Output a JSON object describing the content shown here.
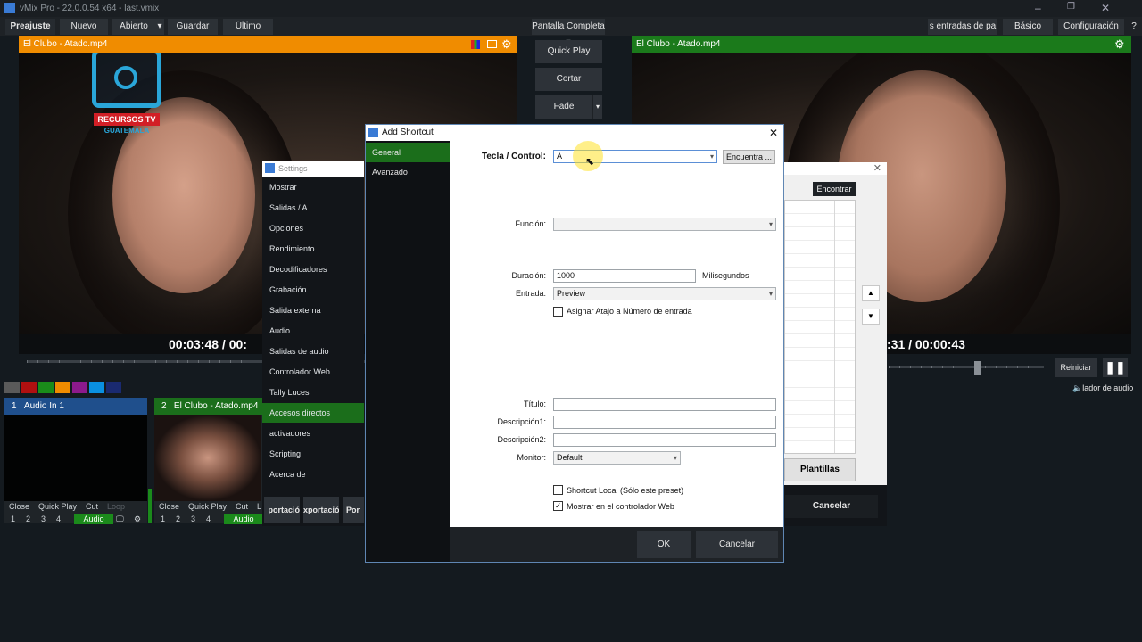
{
  "window": {
    "title": "vMix Pro - 22.0.0.54 x64 - last.vmix",
    "controls": [
      "–",
      "❐",
      "✕"
    ]
  },
  "toolbar": {
    "left": [
      "Preajuste",
      "Nuevo",
      "Abierto",
      "Guardar",
      "Último"
    ],
    "center": "Pantalla Completa",
    "right": [
      "s entradas de pa",
      "Básico",
      "Configuración"
    ],
    "help": "?"
  },
  "preview": {
    "title": "El Clubo - Atado.mp4",
    "timecode": "00:03:48  /  00:",
    "logo_line1": "RECURSOS TV",
    "logo_line2": "GUATEMALA"
  },
  "output": {
    "title": "El Clubo - Atado.mp4",
    "timecode": ":31  /  00:00:43",
    "restart": "Reiniciar",
    "audio_label": "lador de audio"
  },
  "transitions": {
    "quick_play": "Quick Play",
    "cut": "Cortar",
    "fade": "Fade"
  },
  "swatches": [
    "#5a5a5a",
    "#b01010",
    "#1a8c1a",
    "#f08c00",
    "#8c1a8c",
    "#0a90e0",
    "#1a2a70"
  ],
  "inputs": [
    {
      "number": "1",
      "name": "Audio In 1",
      "head_color": "#1f4f8c",
      "buttons": [
        "Close",
        "Quick Play",
        "Cut",
        "Loop"
      ],
      "nums": [
        "1",
        "2",
        "3",
        "4"
      ],
      "audio": "Audio"
    },
    {
      "number": "2",
      "name": "El Clubo - Atado.mp4",
      "head_color": "#1b6e1b",
      "buttons": [
        "Close",
        "Quick Play",
        "Cut",
        "L"
      ],
      "nums": [
        "1",
        "2",
        "3",
        "4"
      ],
      "audio": "Audio"
    }
  ],
  "settings": {
    "title": "Settings",
    "items": [
      "Mostrar",
      "Salidas / A",
      "Opciones",
      "Rendimiento",
      "Decodificadores",
      "Grabación",
      "Salida externa",
      "Audio",
      "Salidas de audio",
      "Controlador Web",
      "Tally Luces",
      "Accesos directos",
      "activadores",
      "Scripting",
      "Acerca de"
    ],
    "selected": "Accesos directos",
    "bottom_buttons": [
      "portació",
      "xportació",
      "Por c"
    ]
  },
  "shortcuts_window": {
    "find_button": "Encontrar",
    "templates_button": "Plantillas",
    "cancel_button": "Cancelar"
  },
  "dialog": {
    "title": "Add Shortcut",
    "tabs": [
      "General",
      "Avanzado"
    ],
    "selected_tab": "General",
    "key_label": "Tecla / Control:",
    "key_value": "A",
    "find_button": "Encuentra ...",
    "function_label": "Función:",
    "function_value": "",
    "duration_label": "Duración:",
    "duration_value": "1000",
    "duration_unit": "Milisegundos",
    "input_label": "Entrada:",
    "input_value": "Preview",
    "assign_label": "Asignar Atajo a Número de entrada",
    "assign_checked": false,
    "title_label": "Título:",
    "title_value": "",
    "desc1_label": "Descripción1:",
    "desc1_value": "",
    "desc2_label": "Descripción2:",
    "desc2_value": "",
    "monitor_label": "Monitor:",
    "monitor_value": "Default",
    "local_label": "Shortcut Local (Sólo este preset)",
    "local_checked": false,
    "web_label": "Mostrar en el controlador Web",
    "web_checked": true,
    "ok_button": "OK",
    "cancel_button": "Cancelar"
  }
}
